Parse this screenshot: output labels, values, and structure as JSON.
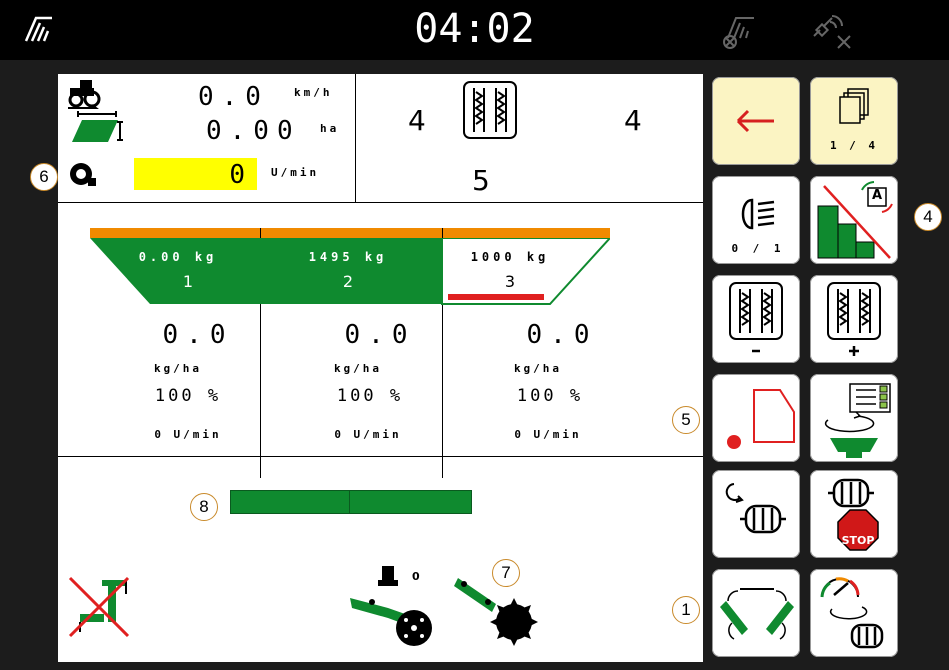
{
  "topbar": {
    "time": "04:02",
    "left_icon": "implement-signal-icon",
    "right_icons": [
      "implement-disconnected-icon",
      "gps-disconnected-icon"
    ]
  },
  "info": {
    "speed_value": "0.0",
    "speed_unit": "km/h",
    "area_value": "0.00",
    "area_unit": "ha",
    "fan_value": "0",
    "fan_unit": "U/min",
    "track_left": "4",
    "track_right": "4",
    "track_center": "5"
  },
  "hoppers": [
    {
      "weight": "0.00 kg",
      "number": "1",
      "rate": "0.0",
      "rate_unit": "kg/ha",
      "percent": "100 %",
      "rpm": "0 U/min"
    },
    {
      "weight": "1495 kg",
      "number": "2",
      "rate": "0.0",
      "rate_unit": "kg/ha",
      "percent": "100 %",
      "rpm": "0 U/min"
    },
    {
      "weight": "1000 kg",
      "number": "3",
      "rate": "0.0",
      "rate_unit": "kg/ha",
      "percent": "100 %",
      "rpm": "0 U/min"
    }
  ],
  "implement": {
    "marker_value": "0"
  },
  "buttons": {
    "page_indicator": "1 / 4",
    "headlight_toggle": "0 / 1",
    "section_auto_badge": "A",
    "stop_label": "STOP"
  },
  "callouts": [
    "1",
    "4",
    "5",
    "6",
    "7",
    "8"
  ],
  "colors": {
    "green": "#0f8a2f",
    "orange": "#f08a00",
    "yellow_field": "#ffff00",
    "button_yellow": "#fbf4c3",
    "red": "#e02020"
  }
}
